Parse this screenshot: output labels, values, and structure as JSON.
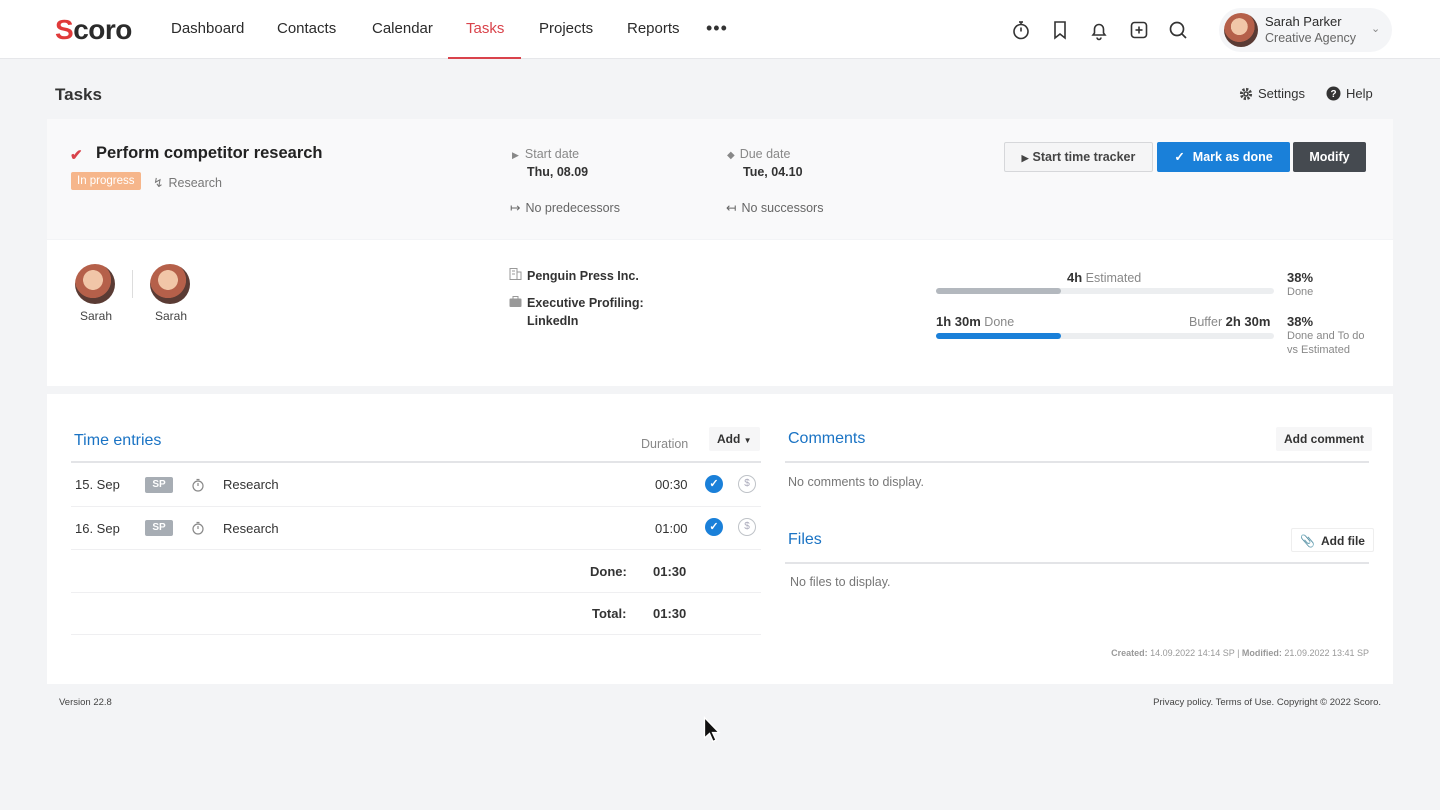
{
  "app": {
    "logo": "Scoro"
  },
  "nav": {
    "items": [
      "Dashboard",
      "Contacts",
      "Calendar",
      "Tasks",
      "Projects",
      "Reports"
    ],
    "active": "Tasks",
    "more": "•••"
  },
  "user": {
    "name": "Sarah Parker",
    "org": "Creative Agency"
  },
  "page": {
    "title": "Tasks",
    "settings": "Settings",
    "help": "Help"
  },
  "task": {
    "title": "Perform competitor research",
    "status": "In progress",
    "tag": "Research",
    "start_label": "Start date",
    "start_value": "Thu, 08.09",
    "due_label": "Due date",
    "due_value": "Tue, 04.10",
    "predecessors": "No predecessors",
    "successors": "No successors",
    "btn_tracker": "Start time tracker",
    "btn_done": "Mark as done",
    "btn_modify": "Modify"
  },
  "assignees": [
    {
      "name": "Sarah"
    },
    {
      "name": "Sarah"
    }
  ],
  "details": {
    "company": "Penguin Press Inc.",
    "project_line1": "Executive Profiling:",
    "project_line2": "LinkedIn"
  },
  "progress": {
    "estimated_value": "4h",
    "estimated_label": "Estimated",
    "estimated_fill": 0.37,
    "done_value": "1h 30m",
    "done_label": "Done",
    "buffer_label": "Buffer",
    "buffer_value": "2h 30m",
    "done_fill": 0.37,
    "pct1": "38%",
    "pct1_label": "Done",
    "pct2": "38%",
    "pct2_label1": "Done and To do",
    "pct2_label2": "vs Estimated",
    "color_estimated": "#b3b8be",
    "color_done": "#1a80d9"
  },
  "time_entries": {
    "title": "Time entries",
    "duration_head": "Duration",
    "add": "Add",
    "rows": [
      {
        "date": "15. Sep",
        "user": "SP",
        "activity": "Research",
        "duration": "00:30"
      },
      {
        "date": "16. Sep",
        "user": "SP",
        "activity": "Research",
        "duration": "01:00"
      }
    ],
    "done_label": "Done:",
    "done_value": "01:30",
    "total_label": "Total:",
    "total_value": "01:30"
  },
  "comments": {
    "title": "Comments",
    "add": "Add comment",
    "empty": "No comments to display."
  },
  "files": {
    "title": "Files",
    "add": "Add file",
    "empty": "No files to display."
  },
  "meta": {
    "created_label": "Created:",
    "created_value": "14.09.2022 14:14 SP",
    "modified_label": "Modified:",
    "modified_value": "21.09.2022 13:41 SP"
  },
  "footer": {
    "version": "Version 22.8",
    "legal": "Privacy policy. Terms of Use. Copyright © 2022 Scoro."
  }
}
